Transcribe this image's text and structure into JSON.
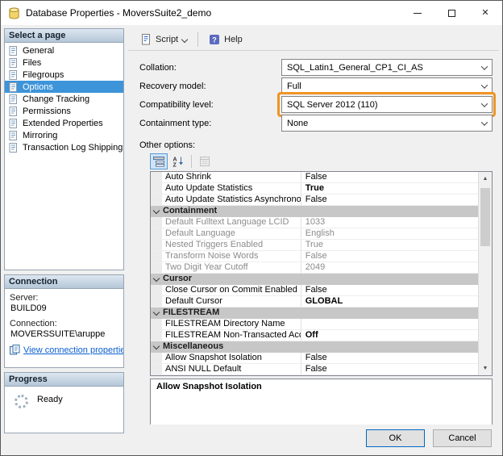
{
  "window": {
    "title": "Database Properties - MoversSuite2_demo"
  },
  "toolbar": {
    "script_label": "Script",
    "help_label": "Help"
  },
  "sidebar": {
    "pages_header": "Select a page",
    "pages": [
      {
        "label": "General",
        "selected": false
      },
      {
        "label": "Files",
        "selected": false
      },
      {
        "label": "Filegroups",
        "selected": false
      },
      {
        "label": "Options",
        "selected": true
      },
      {
        "label": "Change Tracking",
        "selected": false
      },
      {
        "label": "Permissions",
        "selected": false
      },
      {
        "label": "Extended Properties",
        "selected": false
      },
      {
        "label": "Mirroring",
        "selected": false
      },
      {
        "label": "Transaction Log Shipping",
        "selected": false
      }
    ],
    "connection": {
      "header": "Connection",
      "server_label": "Server:",
      "server_value": "BUILD09",
      "connection_label": "Connection:",
      "connection_value": "MOVERSSUITE\\aruppe",
      "link_label": "View connection properties"
    },
    "progress": {
      "header": "Progress",
      "status": "Ready"
    }
  },
  "form": {
    "fields": [
      {
        "label": "Collation:",
        "value": "SQL_Latin1_General_CP1_CI_AS",
        "highlighted": false
      },
      {
        "label": "Recovery model:",
        "value": "Full",
        "highlighted": false
      },
      {
        "label": "Compatibility level:",
        "value": "SQL Server 2012 (110)",
        "highlighted": true
      },
      {
        "label": "Containment type:",
        "value": "None",
        "highlighted": false
      }
    ],
    "other_options_label": "Other options:"
  },
  "grid": {
    "rows": [
      {
        "type": "property",
        "name": "Auto Shrink",
        "value": "False"
      },
      {
        "type": "property",
        "name": "Auto Update Statistics",
        "value": "True",
        "bold": true
      },
      {
        "type": "property",
        "name": "Auto Update Statistics Asynchronously",
        "value": "False"
      },
      {
        "type": "category",
        "name": "Containment"
      },
      {
        "type": "property",
        "name": "Default Fulltext Language LCID",
        "value": "1033",
        "readonly": true
      },
      {
        "type": "property",
        "name": "Default Language",
        "value": "English",
        "readonly": true
      },
      {
        "type": "property",
        "name": "Nested Triggers Enabled",
        "value": "True",
        "readonly": true
      },
      {
        "type": "property",
        "name": "Transform Noise Words",
        "value": "False",
        "readonly": true
      },
      {
        "type": "property",
        "name": "Two Digit Year Cutoff",
        "value": "2049",
        "readonly": true
      },
      {
        "type": "category",
        "name": "Cursor"
      },
      {
        "type": "property",
        "name": "Close Cursor on Commit Enabled",
        "value": "False"
      },
      {
        "type": "property",
        "name": "Default Cursor",
        "value": "GLOBAL",
        "bold": true
      },
      {
        "type": "category",
        "name": "FILESTREAM"
      },
      {
        "type": "property",
        "name": "FILESTREAM Directory Name",
        "value": ""
      },
      {
        "type": "property",
        "name": "FILESTREAM Non-Transacted Access",
        "value": "Off",
        "bold": true
      },
      {
        "type": "category",
        "name": "Miscellaneous"
      },
      {
        "type": "property",
        "name": "Allow Snapshot Isolation",
        "value": "False"
      },
      {
        "type": "property",
        "name": "ANSI NULL Default",
        "value": "False"
      }
    ],
    "description_title": "Allow Snapshot Isolation"
  },
  "footer": {
    "ok_label": "OK",
    "cancel_label": "Cancel"
  },
  "colors": {
    "selection_blue": "#3d94d9",
    "highlight_orange": "#ef9425",
    "link_blue": "#0b5fd3",
    "category_gray": "#c7c7c7"
  }
}
